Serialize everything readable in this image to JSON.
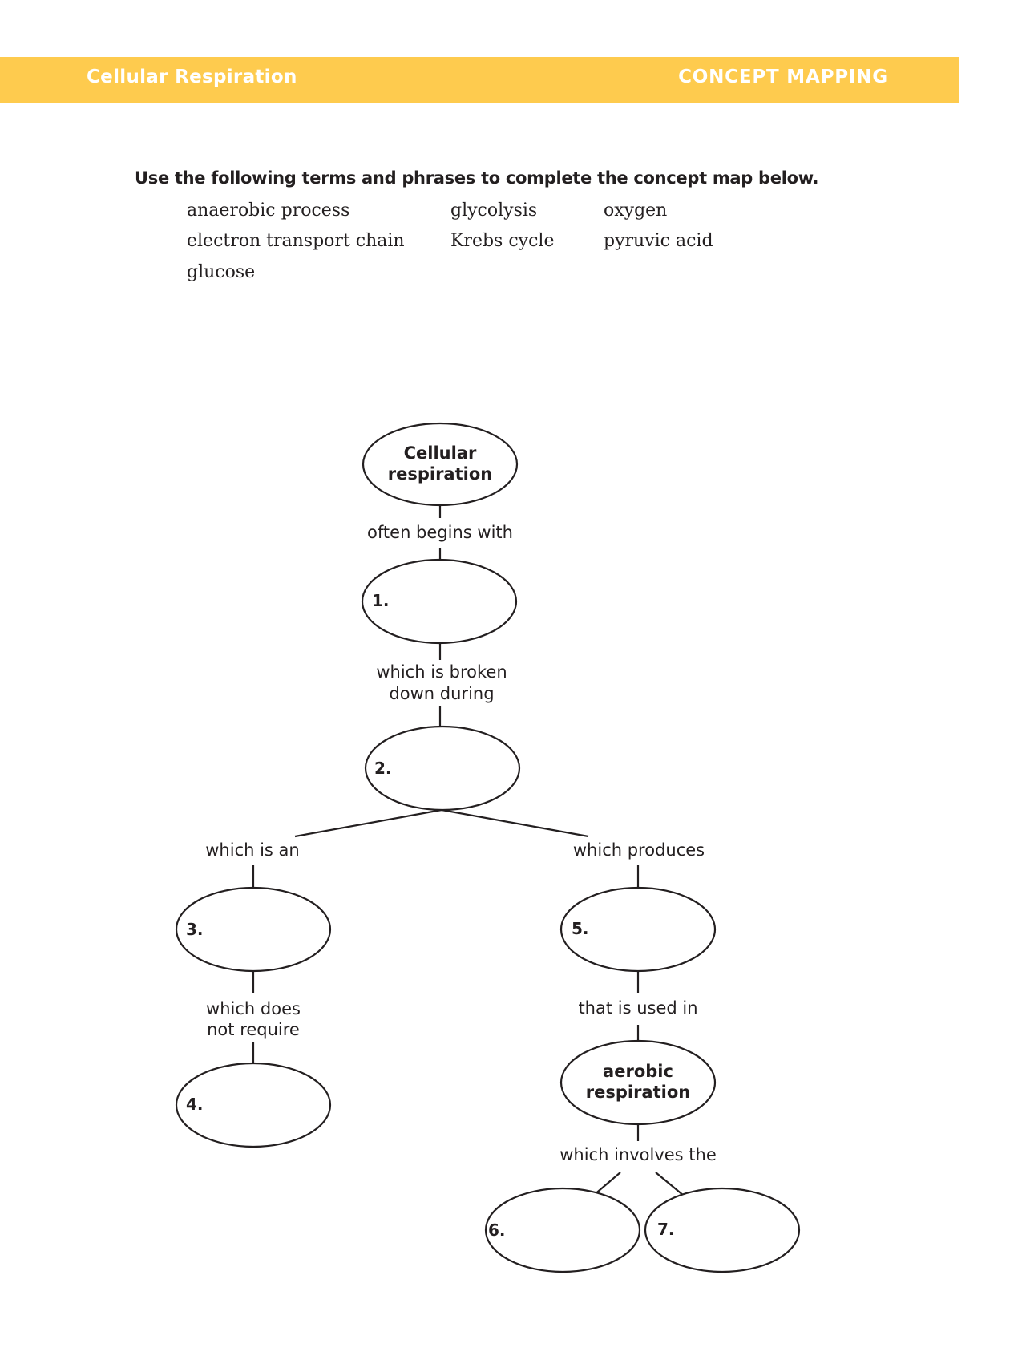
{
  "header": {
    "title": "Cellular Respiration",
    "section": "CONCEPT MAPPING",
    "banner_color": "#FECB4E"
  },
  "instructions": "Use the following terms and phrases to complete the concept map below.",
  "word_bank": [
    "anaerobic process",
    "glycolysis",
    "oxygen",
    "electron transport chain",
    "Krebs cycle",
    "pyruvic acid",
    "glucose"
  ],
  "concept_map": {
    "root": {
      "line1": "Cellular",
      "line2": "respiration"
    },
    "aerobic": {
      "line1": "aerobic",
      "line2": "respiration"
    },
    "blanks": [
      "1.",
      "2.",
      "3.",
      "4.",
      "5.",
      "6.",
      "7."
    ],
    "links": {
      "often_begins_with": "often begins with",
      "broken_down_1": "which is broken",
      "broken_down_2": "down during",
      "which_is_an": "which is an",
      "which_produces": "which produces",
      "does_not_require_1": "which does",
      "does_not_require_2": "not require",
      "used_in": "that is used in",
      "involves_the": "which involves the"
    }
  }
}
